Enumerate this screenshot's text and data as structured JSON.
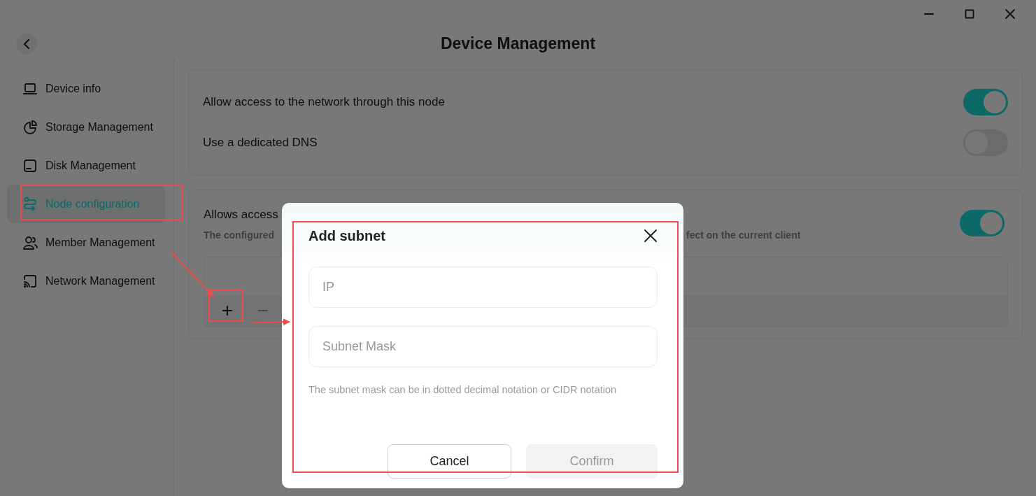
{
  "header": {
    "title": "Device Management"
  },
  "sidebar": {
    "items": [
      {
        "label": "Device info",
        "selected": false
      },
      {
        "label": "Storage Management",
        "selected": false
      },
      {
        "label": "Disk Management",
        "selected": false
      },
      {
        "label": "Node configuration",
        "selected": true
      },
      {
        "label": "Member Management",
        "selected": false
      },
      {
        "label": "Network Management",
        "selected": false
      }
    ]
  },
  "settings": [
    {
      "label": "Allow access to the network through this node",
      "on": true
    },
    {
      "label": "Use a dedicated DNS",
      "on": false
    }
  ],
  "subnet_section": {
    "title": "Allows access",
    "description_left": "The configured",
    "description_right": "fect on the current client",
    "on": true,
    "toolbar": [
      "+",
      "−"
    ]
  },
  "dialog": {
    "title": "Add subnet",
    "fields": [
      {
        "placeholder": "IP"
      },
      {
        "placeholder": "Subnet Mask"
      }
    ],
    "hint": "The subnet mask can be in dotted decimal notation or CIDR notation",
    "buttons": [
      {
        "label": "Cancel",
        "disabled": false
      },
      {
        "label": "Confirm",
        "disabled": true
      }
    ]
  }
}
